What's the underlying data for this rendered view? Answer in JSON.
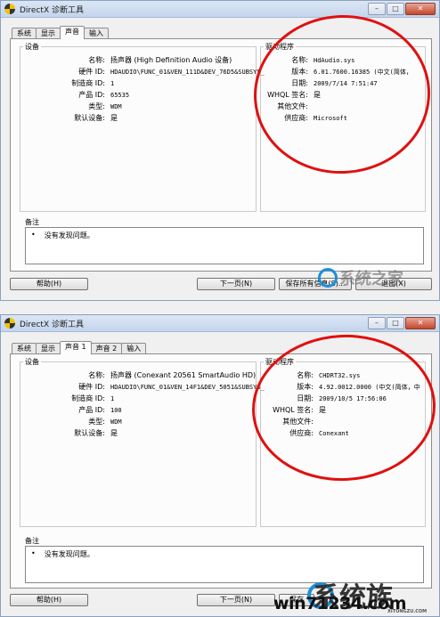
{
  "title": "DirectX 诊断工具",
  "window_controls": {
    "minimize": "–",
    "maximize": "□",
    "close": "✕"
  },
  "windows": [
    {
      "tabs": [
        "系统",
        "显示",
        "声音",
        "输入"
      ],
      "device_group": "设备",
      "driver_group": "驱动程序",
      "device": [
        {
          "key": "名称:",
          "value": "扬声器 (High Definition Audio 设备)"
        },
        {
          "key": "硬件 ID:",
          "value": "HDAUDIO\\FUNC_01&VEN_111D&DEV_76D5&SUBSYS_"
        },
        {
          "key": "制造商 ID:",
          "value": "1"
        },
        {
          "key": "产品 ID:",
          "value": "65535"
        },
        {
          "key": "类型:",
          "value": "WDM"
        },
        {
          "key": "默认设备:",
          "value": "是"
        }
      ],
      "driver": [
        {
          "key": "名称:",
          "value": "HdAudio.sys"
        },
        {
          "key": "版本:",
          "value": "6.01.7600.16385 (中文(简体，"
        },
        {
          "key": "日期:",
          "value": "2009/7/14 7:51:47"
        },
        {
          "key": "WHQL 签名:",
          "value": "是"
        },
        {
          "key": "其他文件:",
          "value": ""
        },
        {
          "key": "供应商:",
          "value": "Microsoft"
        }
      ],
      "notes_label": "备注",
      "note_bullet": "•",
      "note": "没有发现问题。",
      "buttons": {
        "help": "帮助(H)",
        "next": "下一页(N)",
        "save": "保存所有信息(S)...",
        "exit": "退出(X)"
      }
    },
    {
      "tabs": [
        "系统",
        "显示",
        "声音 1",
        "声音 2",
        "输入"
      ],
      "device_group": "设备",
      "driver_group": "驱动程序",
      "device": [
        {
          "key": "名称:",
          "value": "扬声器 (Conexant 20561 SmartAudio HD)"
        },
        {
          "key": "硬件 ID:",
          "value": "HDAUDIO\\FUNC_01&VEN_14F1&DEV_5051&SUBSYS_"
        },
        {
          "key": "制造商 ID:",
          "value": "1"
        },
        {
          "key": "产品 ID:",
          "value": "100"
        },
        {
          "key": "类型:",
          "value": "WDM"
        },
        {
          "key": "默认设备:",
          "value": "是"
        }
      ],
      "driver": [
        {
          "key": "名称:",
          "value": "CHDRT32.sys"
        },
        {
          "key": "版本:",
          "value": "4.92.0012.0000 (中文(简体，中"
        },
        {
          "key": "日期:",
          "value": "2009/10/5 17:56:06"
        },
        {
          "key": "WHQL 签名:",
          "value": "是"
        },
        {
          "key": "其他文件:",
          "value": ""
        },
        {
          "key": "供应商:",
          "value": "Conexant"
        }
      ],
      "notes_label": "备注",
      "note_bullet": "•",
      "note": "没有发现问题。",
      "buttons": {
        "help": "帮助(H)",
        "next": "下一页(N)",
        "save": "保存"
      }
    }
  ],
  "watermark_top": "系统之家",
  "watermark_bottom": "win71234.com",
  "watermark_bottom_small": "XITONGZU.COM",
  "watermark_bottom_cn": "系统族",
  "accent_colors": {
    "annotation_circle": "#e01010",
    "watermark_blue": "#1d8fd6"
  }
}
